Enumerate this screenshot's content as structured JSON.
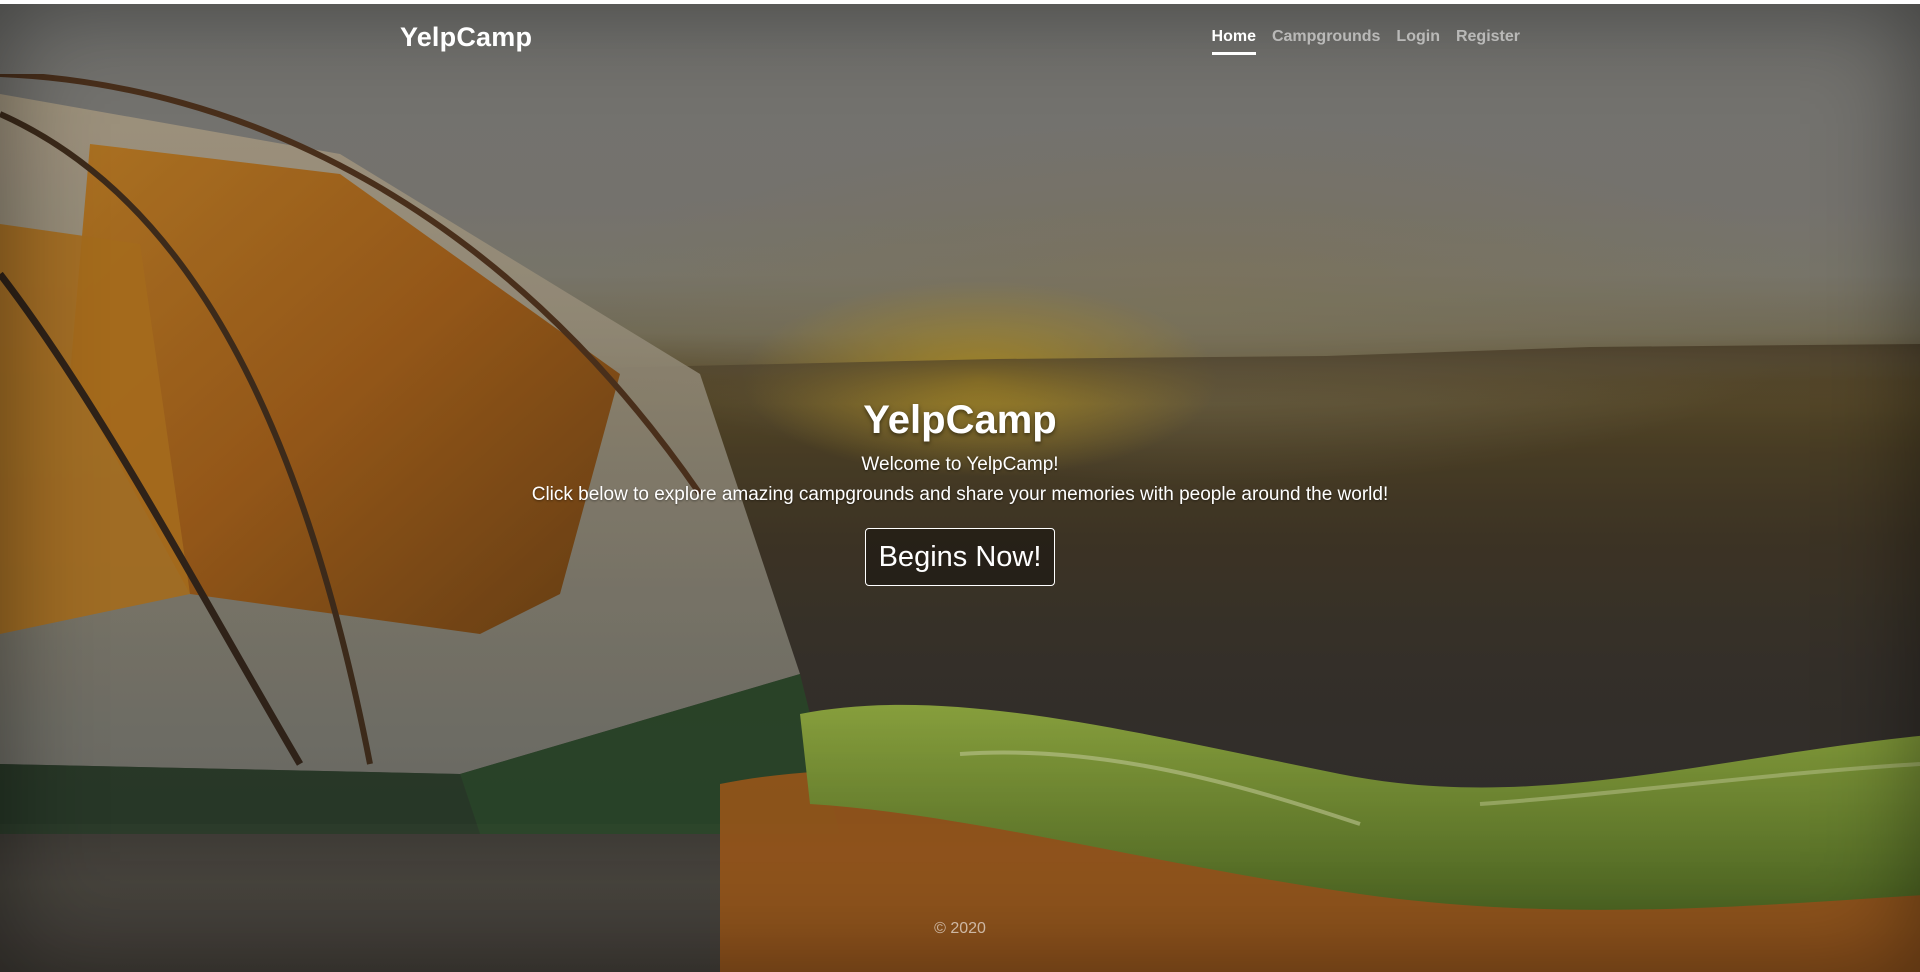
{
  "navbar": {
    "brand": "YelpCamp",
    "links": [
      {
        "label": "Home",
        "active": true
      },
      {
        "label": "Campgrounds",
        "active": false
      },
      {
        "label": "Login",
        "active": false
      },
      {
        "label": "Register",
        "active": false
      }
    ]
  },
  "hero": {
    "title": "YelpCamp",
    "subtitle": "Welcome to YelpCamp!",
    "description": "Click below to explore amazing campgrounds and share your memories with people around the world!",
    "button_label": "Begins Now!"
  },
  "footer": {
    "copyright": "© 2020"
  },
  "colors": {
    "text": "#ffffff",
    "muted_nav": "#a6a6a6"
  },
  "background": {
    "icons": [
      "tent-icon",
      "sleeping-bag-icon"
    ]
  }
}
